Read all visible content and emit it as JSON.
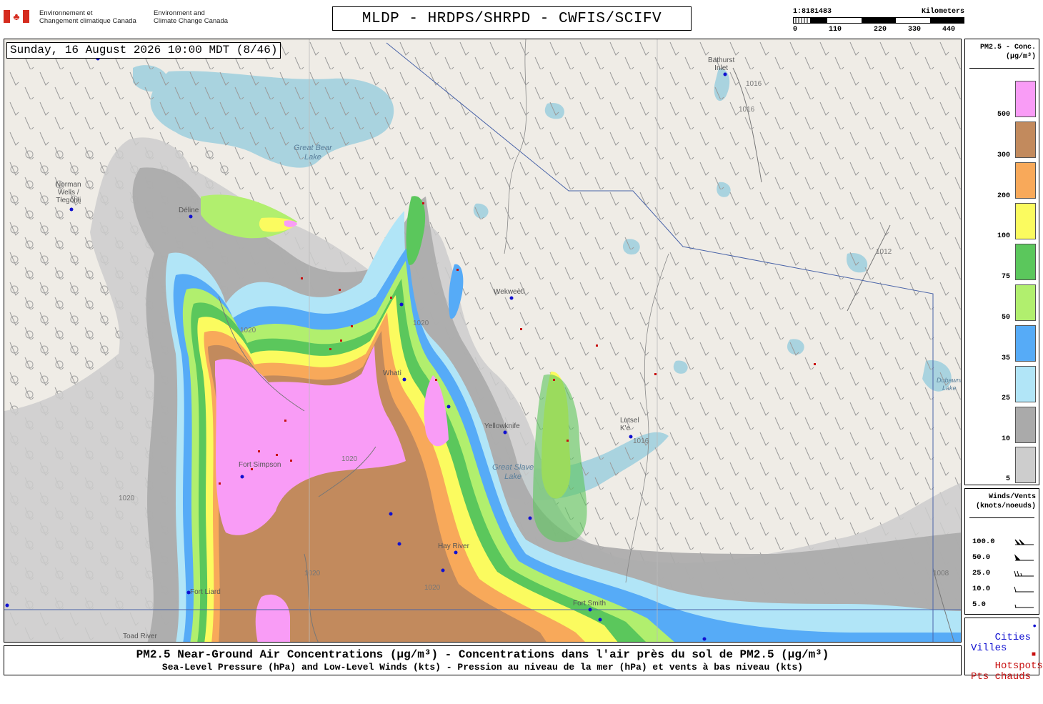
{
  "header": {
    "gov_fr": "Environnement et\nChangement climatique Canada",
    "gov_en": "Environment and\nClimate Change Canada",
    "title": "MLDP - HRDPS/SHRPD - CWFIS/SCIFV"
  },
  "scale": {
    "ratio": "1:8181483",
    "unit": "Kilometers",
    "ticks": [
      "0",
      "110",
      "220",
      "330",
      "440"
    ]
  },
  "map": {
    "datetime": "Sunday, 16 August 2026 10:00 MDT (8/46)",
    "places": [
      {
        "label": "Bathurst\nInlet",
        "kind": "city"
      },
      {
        "label": "Great Bear\nLake",
        "kind": "water"
      },
      {
        "label": "Norman\nWells /\nTłegóhłį",
        "kind": "city"
      },
      {
        "label": "Wekweètì",
        "kind": "city"
      },
      {
        "label": "Yellowknife",
        "kind": "city"
      },
      {
        "label": "Great Slave\nLake",
        "kind": "water"
      },
      {
        "label": "Lutsel\nK'e",
        "kind": "city"
      },
      {
        "label": "Whatì",
        "kind": "city"
      },
      {
        "label": "Fort Simpson",
        "kind": "city"
      },
      {
        "label": "Hay River",
        "kind": "city"
      },
      {
        "label": "Fort Liard",
        "kind": "city"
      },
      {
        "label": "Fort Smith",
        "kind": "city"
      },
      {
        "label": "Toad River",
        "kind": "city"
      },
      {
        "label": "Dubawnt\nLake",
        "kind": "water"
      },
      {
        "label": "Déline",
        "kind": "city"
      }
    ],
    "isobars": [
      "1016",
      "1016",
      "1012",
      "1016",
      "1020",
      "1020",
      "1020",
      "1020",
      "1020",
      "1020",
      "1008"
    ],
    "colors": {
      "land": "#efece6",
      "water": "#a9d3df",
      "boundary": "#4a64a8",
      "river": "#8fb0d4"
    }
  },
  "legend_pm": {
    "title": "PM2.5 - Conc.\n(µg/m³)",
    "classes": [
      {
        "label": "500",
        "color": "#f99cf6"
      },
      {
        "label": "300",
        "color": "#c28a5d"
      },
      {
        "label": "200",
        "color": "#f8a95a"
      },
      {
        "label": "100",
        "color": "#fbfb5f"
      },
      {
        "label": "75",
        "color": "#5bc75c"
      },
      {
        "label": "50",
        "color": "#b1ef6e"
      },
      {
        "label": "35",
        "color": "#56abf7"
      },
      {
        "label": "25",
        "color": "#b1e5f7"
      },
      {
        "label": "10",
        "color": "#aaaaaa"
      },
      {
        "label": "5",
        "color": "#cdcdcd"
      }
    ]
  },
  "legend_wind": {
    "title": "Winds/Vents\n(knots/noeuds)",
    "rows": [
      "100.0",
      "50.0",
      "25.0",
      "10.0",
      "5.0"
    ]
  },
  "legend_points": {
    "cities": "Cities\nVilles",
    "cities_color": "#1010d0",
    "hotspots": "Hotspots\nPts chauds",
    "hotspots_color": "#c81010"
  },
  "footer": {
    "line1": "PM2.5 Near-Ground Air Concentrations (µg/m³) - Concentrations dans l'air près du sol de PM2.5 (µg/m³)",
    "line2": "Sea-Level Pressure (hPa) and Low-Level Winds (kts) - Pression au niveau de la mer (hPa) et vents à bas niveau (kts)"
  }
}
